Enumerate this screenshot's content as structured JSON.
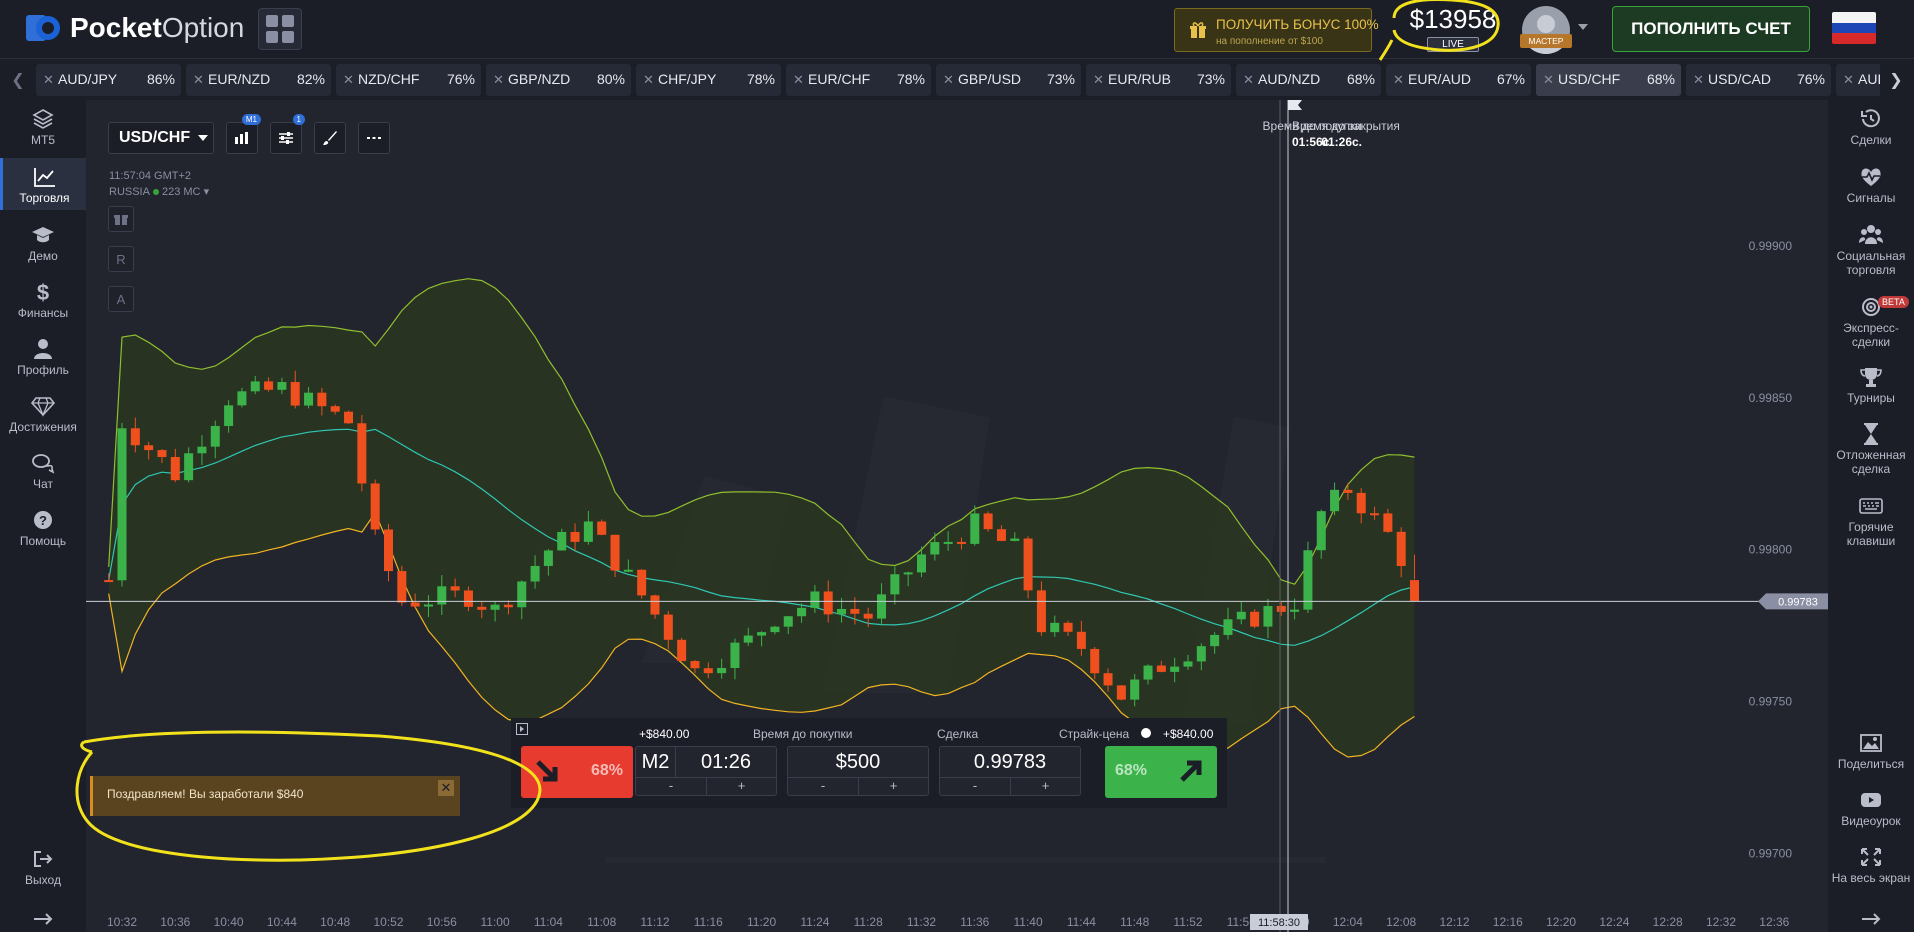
{
  "header": {
    "logo_bold": "Pocket",
    "logo_light": "Option",
    "bonus_title": "ПОЛУЧИТЬ БОНУС 100%",
    "bonus_sub": "на пополнение от $100",
    "balance": "$13958",
    "balance_mode": "LIVE",
    "avatar_badge": "МАСТЕР",
    "deposit_label": "ПОПОЛНИТЬ СЧЕТ"
  },
  "tabs": [
    {
      "symbol": "AUD/JPY",
      "payout": "86%"
    },
    {
      "symbol": "EUR/NZD",
      "payout": "82%"
    },
    {
      "symbol": "NZD/CHF",
      "payout": "76%"
    },
    {
      "symbol": "GBP/NZD",
      "payout": "80%"
    },
    {
      "symbol": "CHF/JPY",
      "payout": "78%"
    },
    {
      "symbol": "EUR/CHF",
      "payout": "78%"
    },
    {
      "symbol": "GBP/USD",
      "payout": "73%"
    },
    {
      "symbol": "EUR/RUB",
      "payout": "73%"
    },
    {
      "symbol": "AUD/NZD",
      "payout": "68%"
    },
    {
      "symbol": "EUR/AUD",
      "payout": "67%"
    },
    {
      "symbol": "USD/CHF",
      "payout": "68%"
    },
    {
      "symbol": "USD/CAD",
      "payout": "76%"
    },
    {
      "symbol": "AUD/",
      "payout": ""
    }
  ],
  "left_sidebar": [
    {
      "label": "MT5",
      "icon": "layers-icon"
    },
    {
      "label": "Торговля",
      "icon": "chart-line-icon"
    },
    {
      "label": "Демо",
      "icon": "graduation-cap-icon"
    },
    {
      "label": "Финансы",
      "icon": "dollar-icon"
    },
    {
      "label": "Профиль",
      "icon": "user-icon"
    },
    {
      "label": "Достижения",
      "icon": "diamond-icon"
    },
    {
      "label": "Чат",
      "icon": "chat-icon"
    },
    {
      "label": "Помощь",
      "icon": "help-icon"
    },
    {
      "label": "Выход",
      "icon": "logout-icon"
    }
  ],
  "right_sidebar": [
    {
      "label": "Сделки",
      "icon": "history-icon"
    },
    {
      "label": "Сигналы",
      "icon": "heartbeat-icon"
    },
    {
      "label": "Социальная торговля",
      "icon": "users-icon"
    },
    {
      "label": "Экспресс-сделки",
      "icon": "target-icon",
      "badge": "BETA"
    },
    {
      "label": "Турниры",
      "icon": "trophy-icon"
    },
    {
      "label": "Отложенная сделка",
      "icon": "hourglass-icon"
    },
    {
      "label": "Горячие клавиши",
      "icon": "keyboard-icon"
    },
    {
      "label": "Поделиться",
      "icon": "image-icon"
    },
    {
      "label": "Видеоурок",
      "icon": "youtube-icon"
    },
    {
      "label": "На весь экран",
      "icon": "fullscreen-icon"
    }
  ],
  "chart": {
    "asset": "USD/CHF",
    "timeframe_badge": "M1",
    "indicator_badge": "1",
    "server_time": "11:57:04 GMT+2",
    "region": "RUSSIA",
    "ping": "223 МС",
    "draw_tools": [
      "R",
      "A"
    ],
    "purchase_label": "Время до покупки",
    "purchase_time": "01:26с.",
    "close_label": "Время до закрытия",
    "close_time": "01:56с.",
    "current_price": "0.99783",
    "cursor_time": "11:58:30"
  },
  "chart_data": {
    "type": "candlestick",
    "y_ticks": [
      "0.99900",
      "0.99850",
      "0.99800",
      "0.99750",
      "0.99700"
    ],
    "ylim": [
      0.99688,
      0.99948
    ],
    "x_ticks": [
      "10:32",
      "10:36",
      "10:40",
      "10:44",
      "10:48",
      "10:52",
      "10:56",
      "11:00",
      "11:04",
      "11:08",
      "11:12",
      "11:16",
      "11:20",
      "11:24",
      "11:28",
      "11:32",
      "11:36",
      "11:40",
      "11:44",
      "11:48",
      "11:52",
      "11:56",
      "12:00",
      "12:04",
      "12:08",
      "12:12",
      "12:16",
      "12:20",
      "12:24",
      "12:28",
      "12:32",
      "12:36"
    ],
    "current_price": 0.99783,
    "indicators": [
      "Bollinger Bands"
    ],
    "colors": {
      "up": "#3bb34a",
      "down": "#f0501e",
      "band_upper": "#8fbf2e",
      "band_lower": "#f0b323",
      "middle": "#2fc7b4",
      "fill": "#2b3a1e"
    }
  },
  "notification": {
    "text": "Поздравляем! Вы заработали $840"
  },
  "trade_panel": {
    "put_payout": "+$840.00",
    "put_pct": "68%",
    "call_payout": "+$840.00",
    "call_pct": "68%",
    "expiry_label": "Время до покупки",
    "expiry_mode": "M2",
    "expiry_time": "01:26",
    "amount_label": "Сделка",
    "amount": "$500",
    "strike_label": "Страйк-цена",
    "strike": "0.99783",
    "minus": "-",
    "plus": "+"
  }
}
